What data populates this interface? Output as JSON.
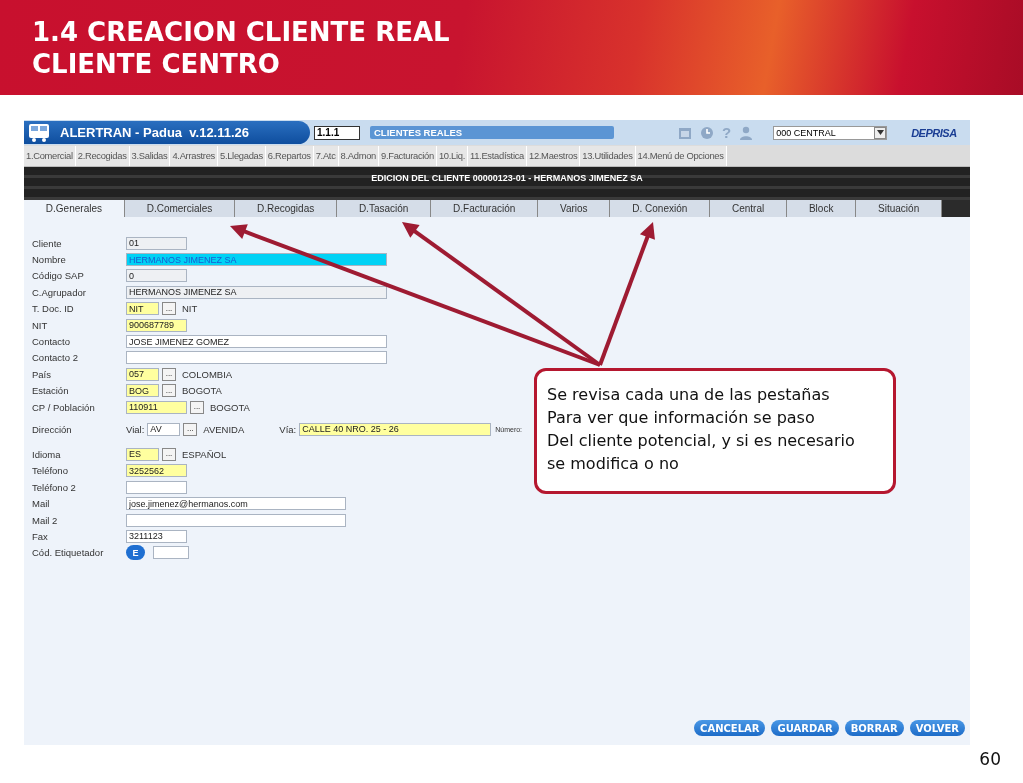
{
  "slide": {
    "title_lines": [
      "1.4 CREACION CLIENTE REAL",
      "CLIENTE CENTRO"
    ],
    "page_number": "60"
  },
  "app": {
    "title": "ALERTRAN - Padua  v.12.11.26",
    "option_code": "1.1.1",
    "screen_name": "CLIENTES REALES",
    "help_icon": "?",
    "branch": "000 CENTRAL",
    "logo": "DEPRISA"
  },
  "menu": [
    {
      "label": "1.Comercial"
    },
    {
      "label": "2.Recogidas"
    },
    {
      "label": "3.Salidas"
    },
    {
      "label": "4.Arrastres"
    },
    {
      "label": "5.Llegadas"
    },
    {
      "label": "6.Repartos"
    },
    {
      "label": "7.Atc"
    },
    {
      "label": "8.Admon"
    },
    {
      "label": "9.Facturación"
    },
    {
      "label": "10.Liq."
    },
    {
      "label": "11.Estadística"
    },
    {
      "label": "12.Maestros"
    },
    {
      "label": "13.Utilidades"
    },
    {
      "label": "14.Menú de Opciones"
    }
  ],
  "header": "EDICION DEL CLIENTE 00000123-01 - HERMANOS JIMENEZ SA",
  "tabs": [
    {
      "label": "D.Generales",
      "selected": true
    },
    {
      "label": "D.Comerciales",
      "selected": false
    },
    {
      "label": "D.Recogidas",
      "selected": false
    },
    {
      "label": "D.Tasación",
      "selected": false
    },
    {
      "label": "D.Facturación",
      "selected": false
    },
    {
      "label": "Varios",
      "selected": false
    },
    {
      "label": "D. Conexión",
      "selected": false
    },
    {
      "label": "Central",
      "selected": false
    },
    {
      "label": "Block",
      "selected": false
    },
    {
      "label": "Situación",
      "selected": false
    }
  ],
  "fields": [
    {
      "kind": "code",
      "label": "Cliente",
      "value": "01",
      "readonly": true,
      "required": false,
      "highlighted": false
    },
    {
      "kind": "line",
      "label": "Nombre",
      "value": "HERMANOS JIMENEZ SA",
      "readonly": false,
      "required": false,
      "highlighted": true
    },
    {
      "kind": "code",
      "label": "Código SAP",
      "value": "0",
      "readonly": true,
      "required": false,
      "highlighted": false
    },
    {
      "kind": "line",
      "label": "C.Agrupador",
      "value": "HERMANOS JIMENEZ SA",
      "readonly": true,
      "required": false,
      "highlighted": false
    },
    {
      "kind": "lookup",
      "label": "T. Doc. ID",
      "value": "NIT",
      "readonly": false,
      "required": true,
      "highlighted": false,
      "button": "...",
      "description": "NIT"
    },
    {
      "kind": "code",
      "label": "NIT",
      "value": "900687789",
      "readonly": false,
      "required": true,
      "highlighted": false
    },
    {
      "kind": "line",
      "label": "Contacto",
      "value": "JOSE JIMENEZ GOMEZ",
      "readonly": false,
      "required": false,
      "highlighted": false
    },
    {
      "kind": "line",
      "label": "Contacto 2",
      "readonly": false,
      "required": false,
      "highlighted": false
    },
    {
      "kind": "lookup",
      "label": "País",
      "value": "057",
      "readonly": false,
      "required": true,
      "highlighted": false,
      "button": "...",
      "description": "COLOMBIA"
    },
    {
      "kind": "lookup",
      "label": "Estación",
      "value": "BOG",
      "readonly": false,
      "required": true,
      "highlighted": false,
      "button": "...",
      "description": "BOGOTA"
    },
    {
      "kind": "lookup-wide",
      "label": "CP / Población",
      "value": "110911",
      "readonly": false,
      "required": true,
      "highlighted": false,
      "button": "...",
      "description": "BOGOTA"
    },
    {
      "kind": "address",
      "label": "Dirección",
      "vial_label": "Vial:",
      "value": "AV",
      "readonly": false,
      "required": false,
      "highlighted": false,
      "button": "...",
      "description": "AVENIDA",
      "via_label": "Vía:",
      "via_value": "CALLE 40 NRO. 25 - 26",
      "number_label": "Número:"
    },
    {
      "kind": "lookup",
      "label": "Idioma",
      "value": "ES",
      "readonly": false,
      "required": true,
      "highlighted": false,
      "button": "...",
      "description": "ESPAÑOL"
    },
    {
      "kind": "code",
      "label": "Teléfono",
      "value": "3252562",
      "readonly": false,
      "required": true,
      "highlighted": false
    },
    {
      "kind": "code",
      "label": "Teléfono 2",
      "readonly": false,
      "required": false,
      "highlighted": false
    },
    {
      "kind": "mail",
      "label": "Mail",
      "value": "jose.jimenez@hermanos.com",
      "readonly": false,
      "required": false,
      "highlighted": false
    },
    {
      "kind": "mail",
      "label": "Mail 2",
      "readonly": false,
      "required": false,
      "highlighted": false
    },
    {
      "kind": "code",
      "label": "Fax",
      "value": "3211123",
      "readonly": false,
      "required": false,
      "highlighted": false
    },
    {
      "kind": "tagger",
      "label": "Cód. Etiquetador",
      "button": "E",
      "readonly": false,
      "required": false,
      "highlighted": false
    }
  ],
  "actions": [
    {
      "label": "CANCELAR"
    },
    {
      "label": "GUARDAR"
    },
    {
      "label": "BORRAR"
    },
    {
      "label": "VOLVER"
    }
  ],
  "callout": {
    "text": "Se revisa cada una de las pestañas\nPara ver que información se paso\nDel cliente potencial, y si es necesario\nse modifica o no"
  }
}
